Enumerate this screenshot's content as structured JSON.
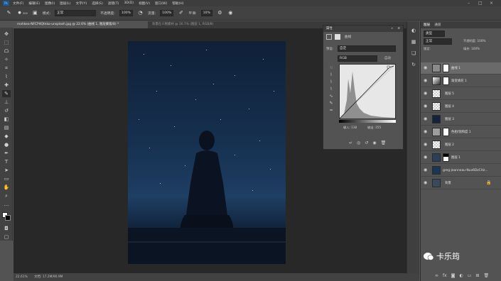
{
  "menu": [
    "文件(F)",
    "编辑(E)",
    "图像(I)",
    "图层(L)",
    "文字(Y)",
    "选择(S)",
    "滤镜(T)",
    "3D(D)",
    "视图(V)",
    "窗口(W)",
    "帮助(H)"
  ],
  "ps_logo": "Ps",
  "options": {
    "brush_size": "300",
    "mode_label": "模式:",
    "mode_value": "正常",
    "opacity_label": "不透明度:",
    "opacity_value": "100%",
    "flow_label": "流量:",
    "flow_value": "100%",
    "smooth_label": "平滑:",
    "smooth_value": "10%"
  },
  "tabs": [
    {
      "label": "mahkeo-NFCP4Qtnko-unsplash.jpg @ 22.6% (曲线 1, 图层蒙版/8) *"
    },
    {
      "label": "背景在人物素材 @ 16.7% (图层 1, RGB/8)"
    }
  ],
  "properties": {
    "header": "属性",
    "title": "曲线",
    "preset_label": "预设:",
    "preset_value": "自定",
    "auto_label": "自动",
    "channel_value": "RGB",
    "input_label": "输入: 138",
    "output_label": "输出: 255"
  },
  "layers_panel": {
    "tab_layers": "图层",
    "tab_channels": "通道",
    "kind_label": "类型",
    "blend_mode": "正常",
    "opacity_label": "不透明度: 100%",
    "lock_label": "锁定:",
    "fill_label": "填充: 100%"
  },
  "layers": [
    {
      "name": "曲线 1"
    },
    {
      "name": "渐变填充 1"
    },
    {
      "name": "图层 5"
    },
    {
      "name": "图层 4"
    },
    {
      "name": "图层 3"
    },
    {
      "name": "色相/饱和度 1"
    },
    {
      "name": "图层 2"
    },
    {
      "name": "图层 1"
    },
    {
      "name": "greg-jeanneau-Nux6DzCHz..."
    },
    {
      "name": "背景"
    }
  ],
  "status": {
    "zoom": "22.61%",
    "doc": "文档: 17.2M/90.9M"
  },
  "watermark": "卡乐筠"
}
